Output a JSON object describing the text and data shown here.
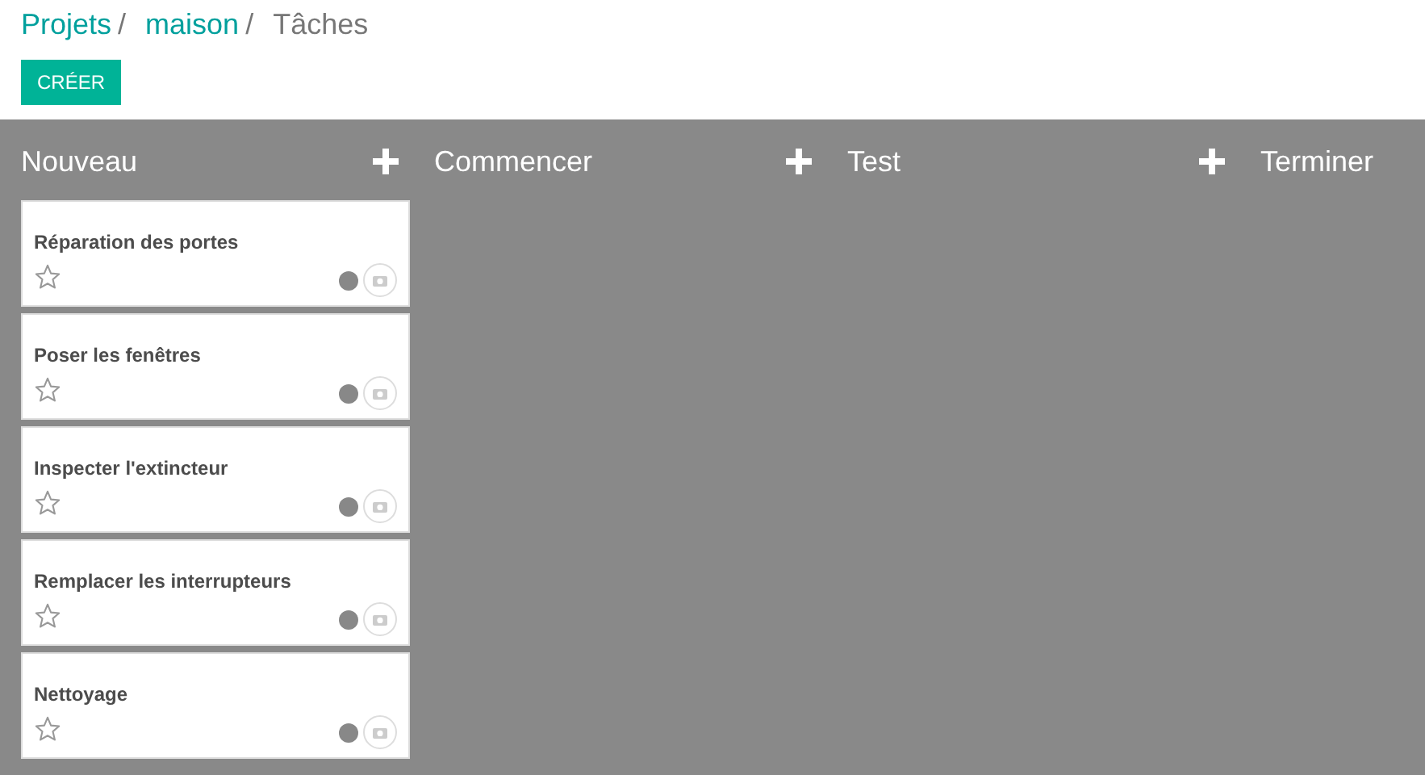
{
  "breadcrumb": [
    {
      "label": "Projets",
      "link": true
    },
    {
      "label": "maison",
      "link": true
    },
    {
      "label": "Tâches",
      "link": false
    }
  ],
  "separator": "/",
  "create_button": "CRÉER",
  "columns": [
    {
      "title": "Nouveau",
      "cards": [
        {
          "title": "Réparation des portes",
          "starred": false
        },
        {
          "title": "Poser les fenêtres",
          "starred": false
        },
        {
          "title": "Inspecter l'extincteur",
          "starred": false
        },
        {
          "title": "Remplacer les interrupteurs",
          "starred": false
        },
        {
          "title": "Nettoyage",
          "starred": false
        }
      ]
    },
    {
      "title": "Commencer"
    },
    {
      "title": "Test"
    },
    {
      "title": "Terminer"
    }
  ]
}
